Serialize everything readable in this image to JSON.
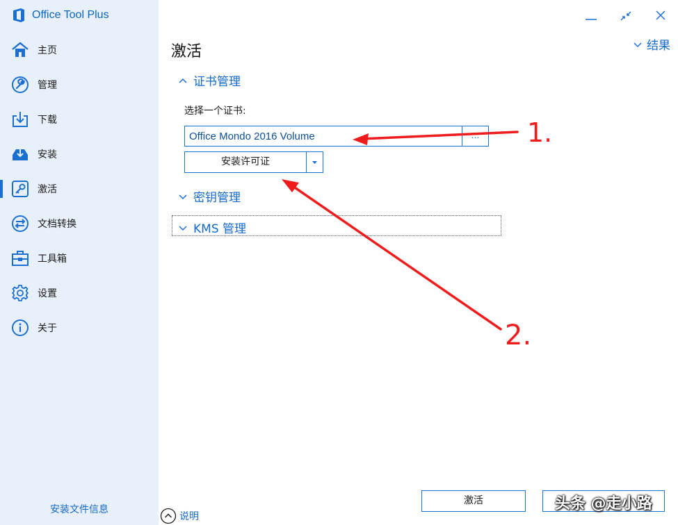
{
  "app": {
    "title": "Office Tool Plus"
  },
  "sidebar": {
    "items": [
      {
        "label": "主页",
        "icon": "home-icon"
      },
      {
        "label": "管理",
        "icon": "wrench-icon"
      },
      {
        "label": "下载",
        "icon": "download-icon"
      },
      {
        "label": "安装",
        "icon": "install-tray-icon"
      },
      {
        "label": "激活",
        "icon": "key-icon",
        "active": true
      },
      {
        "label": "文档转换",
        "icon": "convert-arrows-icon"
      },
      {
        "label": "工具箱",
        "icon": "toolbox-icon"
      },
      {
        "label": "设置",
        "icon": "gear-icon"
      },
      {
        "label": "关于",
        "icon": "info-icon"
      }
    ],
    "install_info_link": "安装文件信息"
  },
  "main": {
    "page_title": "激活",
    "results_toggle": "结果",
    "cert_section": {
      "header": "证书管理",
      "expanded": true,
      "select_label": "选择一个证书:",
      "selected_cert": "Office Mondo 2016 Volume",
      "browse_label": "...",
      "install_button": "安装许可证"
    },
    "key_section": {
      "header": "密钥管理",
      "expanded": false
    },
    "kms_section": {
      "header": "KMS 管理",
      "expanded": false
    },
    "help_toggle": "说明",
    "activate_button": "激活"
  },
  "annotations": {
    "label_1": "1.",
    "label_2": "2."
  },
  "watermark": "头条 @走小路",
  "colors": {
    "accent": "#1a6fd1",
    "sidebar_bg": "#e8f1fb",
    "annotation": "#ee1c1c"
  }
}
